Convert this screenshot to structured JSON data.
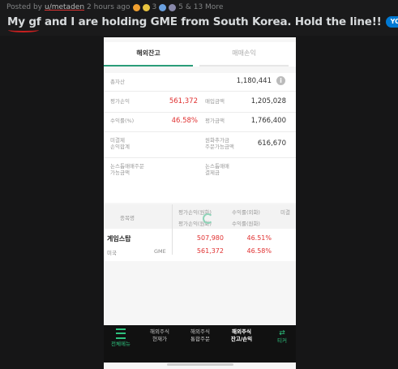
{
  "post": {
    "meta_prefix": "Posted by",
    "username": "u/metaden",
    "time": "2 hours ago",
    "award_count": "3",
    "more_awards": "5 & 13 More",
    "title": "My gf and I are holding GME from South Korea. Hold the line!!",
    "flair": "YOLO",
    "colors": {
      "flair": "#0079d3",
      "underline": "#c82020"
    }
  },
  "app": {
    "tabs": [
      "해외잔고",
      "매매손익"
    ],
    "summary": {
      "total_assets_label": "총자산",
      "total_assets_value": "1,180,441",
      "eval_pl_label": "평가손익",
      "eval_pl_value": "561,372",
      "buy_amount_label": "매입금액",
      "buy_amount_value": "1,205,028",
      "return_label": "수익률(%)",
      "return_value": "46.58%",
      "eval_amount_label": "평가금액",
      "eval_amount_value": "1,766,400",
      "unsettled_label_1": "미결제",
      "unsettled_label_2": "손익합계",
      "won_deposit_label_1": "원화추가금",
      "won_deposit_label_2": "주문가능금액",
      "won_deposit_value": "616,670",
      "nonstop_label_1": "논스톱매매주문",
      "nonstop_label_2": "가능금액",
      "nonstop_settle_label_1": "논스톱매매",
      "nonstop_settle_label_2": "결제금"
    },
    "grid": {
      "col_name": "종목명",
      "col_eval_pl_won": "평가손익(원화)",
      "col_return_fx": "수익률(외화)",
      "col_eval_pl_won_2": "평가손익(원화)",
      "col_return_won": "수익률(원화)",
      "col_extra": "미결",
      "stock_name": "게임스탑",
      "market": "미국",
      "ticker": "GME",
      "pl_fx": "507,980",
      "ret_fx": "46.51%",
      "pl_won": "561,372",
      "ret_won": "46.58%",
      "colors": {
        "positive": "#e03131"
      }
    },
    "nav": [
      {
        "label_1": "",
        "label_2": "전체메뉴",
        "icon": "menu-icon"
      },
      {
        "label_1": "해외주식",
        "label_2": "현재가"
      },
      {
        "label_1": "해외주식",
        "label_2": "통합주문"
      },
      {
        "label_1": "해외주식",
        "label_2": "잔고/손익"
      },
      {
        "label_1": "",
        "label_2": "티커"
      }
    ]
  }
}
